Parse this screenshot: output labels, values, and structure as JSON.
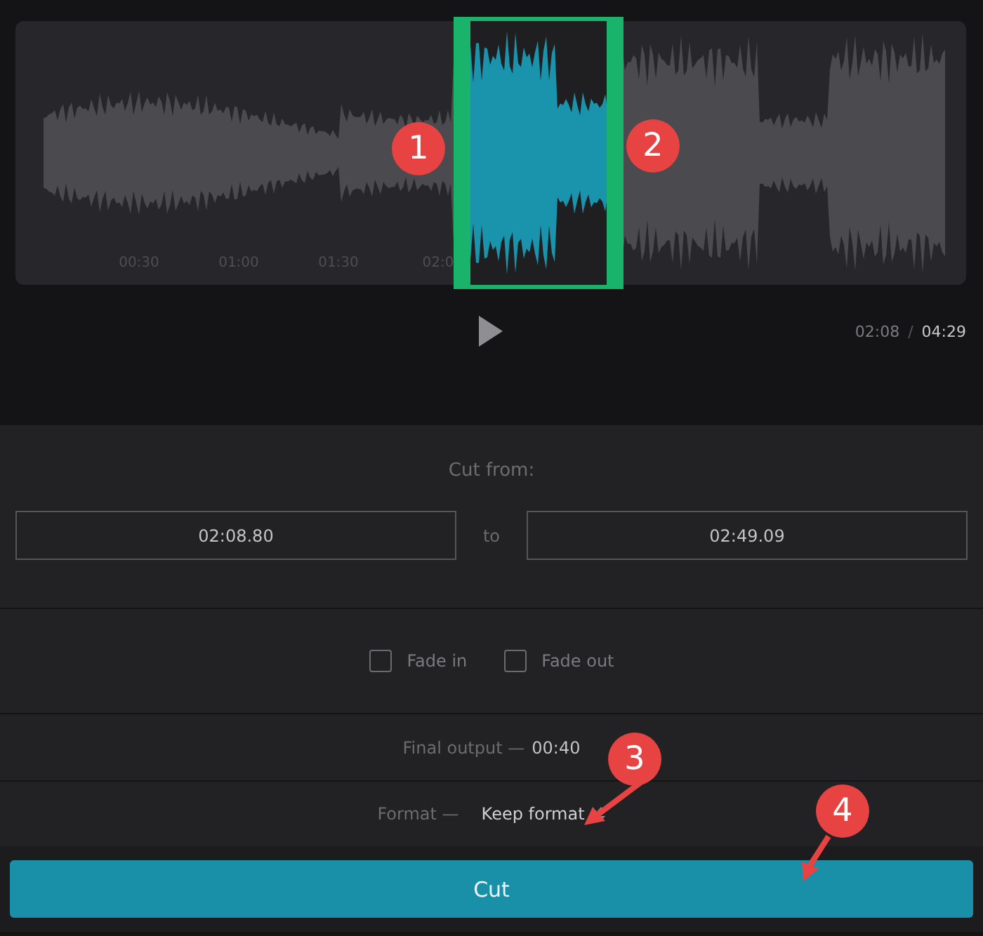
{
  "waveform": {
    "time_ticks": [
      "00:30",
      "01:00",
      "01:30",
      "02:0"
    ]
  },
  "player": {
    "current_time": "02:08",
    "separator": "/",
    "total_time": "04:29"
  },
  "cut_range": {
    "heading": "Cut from:",
    "start": "02:08.80",
    "joiner": "to",
    "end": "02:49.09"
  },
  "fades": [
    {
      "label": "Fade in",
      "checked": false
    },
    {
      "label": "Fade out",
      "checked": false
    }
  ],
  "final_output": {
    "label": "Final output —",
    "value": "00:40"
  },
  "format": {
    "label": "Format —",
    "value": "Keep format"
  },
  "cut_button": {
    "label": "Cut"
  },
  "annotations": [
    {
      "label": "1"
    },
    {
      "label": "2"
    },
    {
      "label": "3"
    },
    {
      "label": "4"
    }
  ]
}
